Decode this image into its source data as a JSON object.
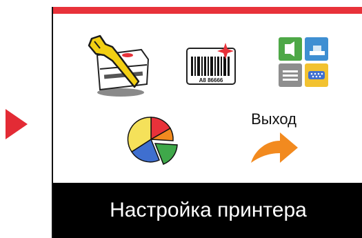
{
  "menu": {
    "exit_label": "Выход",
    "selected_title": "Настройка принтера"
  },
  "barcode": {
    "text": "A8 86666"
  },
  "colors": {
    "accent_red": "#e8323a",
    "arrow_orange": "#f28a1f",
    "footer_bg": "#000000",
    "footer_text": "#ffffff"
  },
  "icons": [
    "printer-setup-icon",
    "barcode-icon",
    "interfaces-icon",
    "statistics-pie-icon",
    "exit-arrow-icon",
    "nav-arrow-icon"
  ]
}
